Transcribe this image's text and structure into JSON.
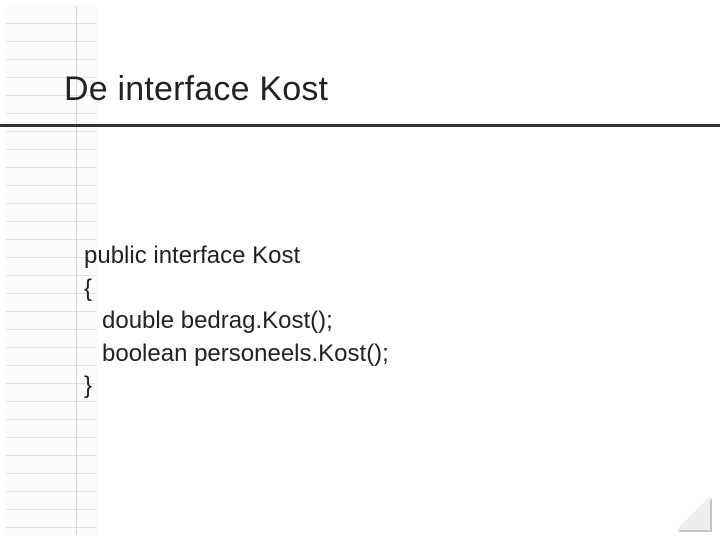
{
  "slide": {
    "title": "De interface Kost",
    "code": {
      "line1": "public interface Kost",
      "line2": "{",
      "line3": "double bedrag.Kost();",
      "line4": "boolean personeels.Kost();",
      "line5": "}"
    }
  }
}
